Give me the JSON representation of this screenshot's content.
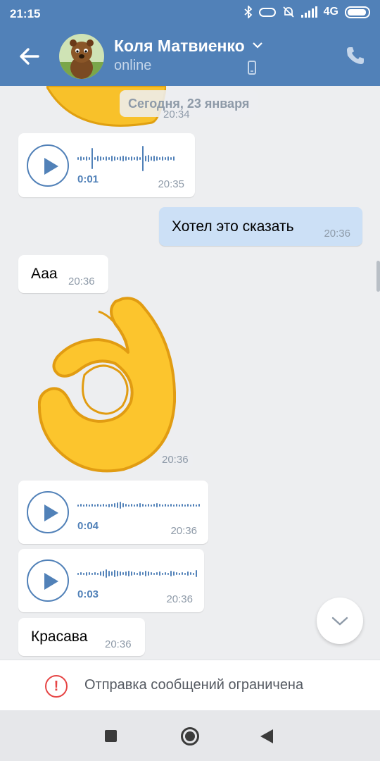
{
  "statusbar": {
    "time": "21:15",
    "network": "4G"
  },
  "header": {
    "contact_name": "Коля Матвиенко",
    "status": "online"
  },
  "chat": {
    "date_label": "Сегодня, 23 января",
    "first_sticker_time": "20:34",
    "messages": [
      {
        "type": "voice",
        "direction": "in",
        "duration": "0:01",
        "time": "20:35"
      },
      {
        "type": "text",
        "direction": "out",
        "text": "Хотел это сказать",
        "time": "20:36"
      },
      {
        "type": "text",
        "direction": "in",
        "text": "Ааа",
        "time": "20:36"
      },
      {
        "type": "sticker",
        "direction": "in",
        "sticker": "ok-hand",
        "time": "20:36"
      },
      {
        "type": "voice",
        "direction": "in",
        "duration": "0:04",
        "time": "20:36"
      },
      {
        "type": "voice",
        "direction": "in",
        "duration": "0:03",
        "time": "20:36"
      },
      {
        "type": "text",
        "direction": "in",
        "text": "Красава",
        "time": "20:36"
      }
    ]
  },
  "footer": {
    "restricted_text": "Отправка сообщений ограничена"
  },
  "colors": {
    "accent": "#5181b8",
    "outgoing_bubble": "#cce0f6",
    "warning": "#e64646",
    "background": "#edeef0"
  },
  "icons": [
    "bluetooth-icon",
    "alarm-off-icon",
    "signal-icon",
    "battery-icon",
    "back-arrow-icon",
    "chevron-down-icon",
    "mobile-phone-icon",
    "call-icon",
    "play-icon",
    "ok-hand-sticker",
    "scroll-down-icon",
    "warning-icon"
  ]
}
